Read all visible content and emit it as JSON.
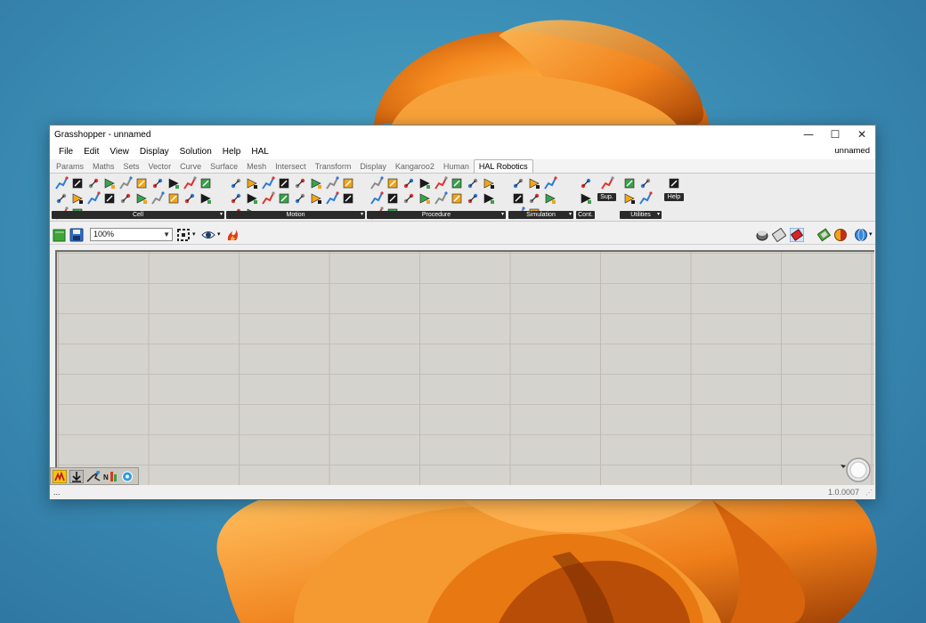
{
  "window": {
    "title": "Grasshopper - unnamed",
    "document_name": "unnamed",
    "controls": {
      "minimize": "—",
      "maximize": "☐",
      "close": "✕"
    }
  },
  "menu": [
    "File",
    "Edit",
    "View",
    "Display",
    "Solution",
    "Help",
    "HAL"
  ],
  "tabs": [
    "Params",
    "Maths",
    "Sets",
    "Vector",
    "Curve",
    "Surface",
    "Mesh",
    "Intersect",
    "Transform",
    "Display",
    "Kangaroo2",
    "Human",
    "HAL Robotics"
  ],
  "active_tab": "HAL Robotics",
  "ribbon_groups": {
    "cell": "Cell",
    "motion": "Motion",
    "procedure": "Procedure",
    "simulation": "Simulation",
    "cont": "Cont.",
    "sup": "Sup.",
    "utilities": "Utilities",
    "help": "Help"
  },
  "toolbar": {
    "zoom_value": "100%",
    "icons": [
      "open-file-icon",
      "save-icon",
      "zoom-dropdown",
      "sketch-frame-icon",
      "preview-eye-icon",
      "bake-flame-icon"
    ],
    "right_icons": [
      "preview-shaded-icon",
      "preview-wire-icon",
      "selected-only-icon",
      "preview-mesh-icon",
      "color-preview-icon",
      "globe-icon"
    ]
  },
  "colors": {
    "canvas": "#d5d3cd",
    "accent_orange": "#f08a24",
    "ribbon_label": "#2a2a2a"
  },
  "status": {
    "left": "...",
    "version": "1.0.0007"
  }
}
